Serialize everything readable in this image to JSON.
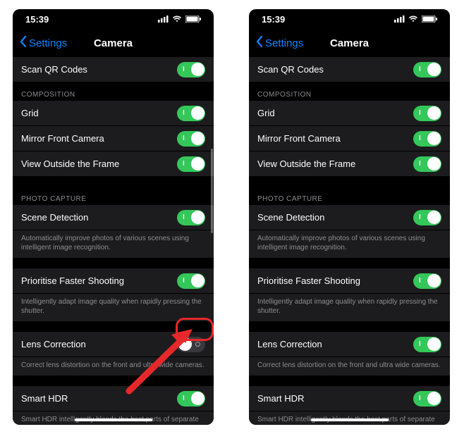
{
  "status": {
    "time": "15:39"
  },
  "nav": {
    "back": "Settings",
    "title": "Camera"
  },
  "left": {
    "qr": "Scan QR Codes",
    "comp_header": "COMPOSITION",
    "grid": "Grid",
    "mirror": "Mirror Front Camera",
    "view_out": "View Outside the Frame",
    "photo_header": "PHOTO CAPTURE",
    "scene": "Scene Detection",
    "scene_foot": "Automatically improve photos of various scenes using intelligent image recognition.",
    "faster": "Prioritise Faster Shooting",
    "faster_foot": "Intelligently adapt image quality when rapidly pressing the shutter.",
    "lens": "Lens Correction",
    "lens_foot": "Correct lens distortion on the front and ultra wide cameras.",
    "hdr": "Smart HDR",
    "hdr_foot": "Smart HDR intelligently blends the best parts of separate exposures into a single photo."
  },
  "right": {
    "qr": "Scan QR Codes",
    "comp_header": "COMPOSITION",
    "grid": "Grid",
    "mirror": "Mirror Front Camera",
    "view_out": "View Outside the Frame",
    "photo_header": "PHOTO CAPTURE",
    "scene": "Scene Detection",
    "scene_foot": "Automatically improve photos of various scenes using intelligent image recognition.",
    "faster": "Prioritise Faster Shooting",
    "faster_foot": "Intelligently adapt image quality when rapidly pressing the shutter.",
    "lens": "Lens Correction",
    "lens_foot": "Correct lens distortion on the front and ultra wide cameras.",
    "hdr": "Smart HDR",
    "hdr_foot": "Smart HDR intelligently blends the best parts of separate exposures into a single photo."
  },
  "toggles": {
    "left_lens": "off",
    "right_lens": "on"
  }
}
